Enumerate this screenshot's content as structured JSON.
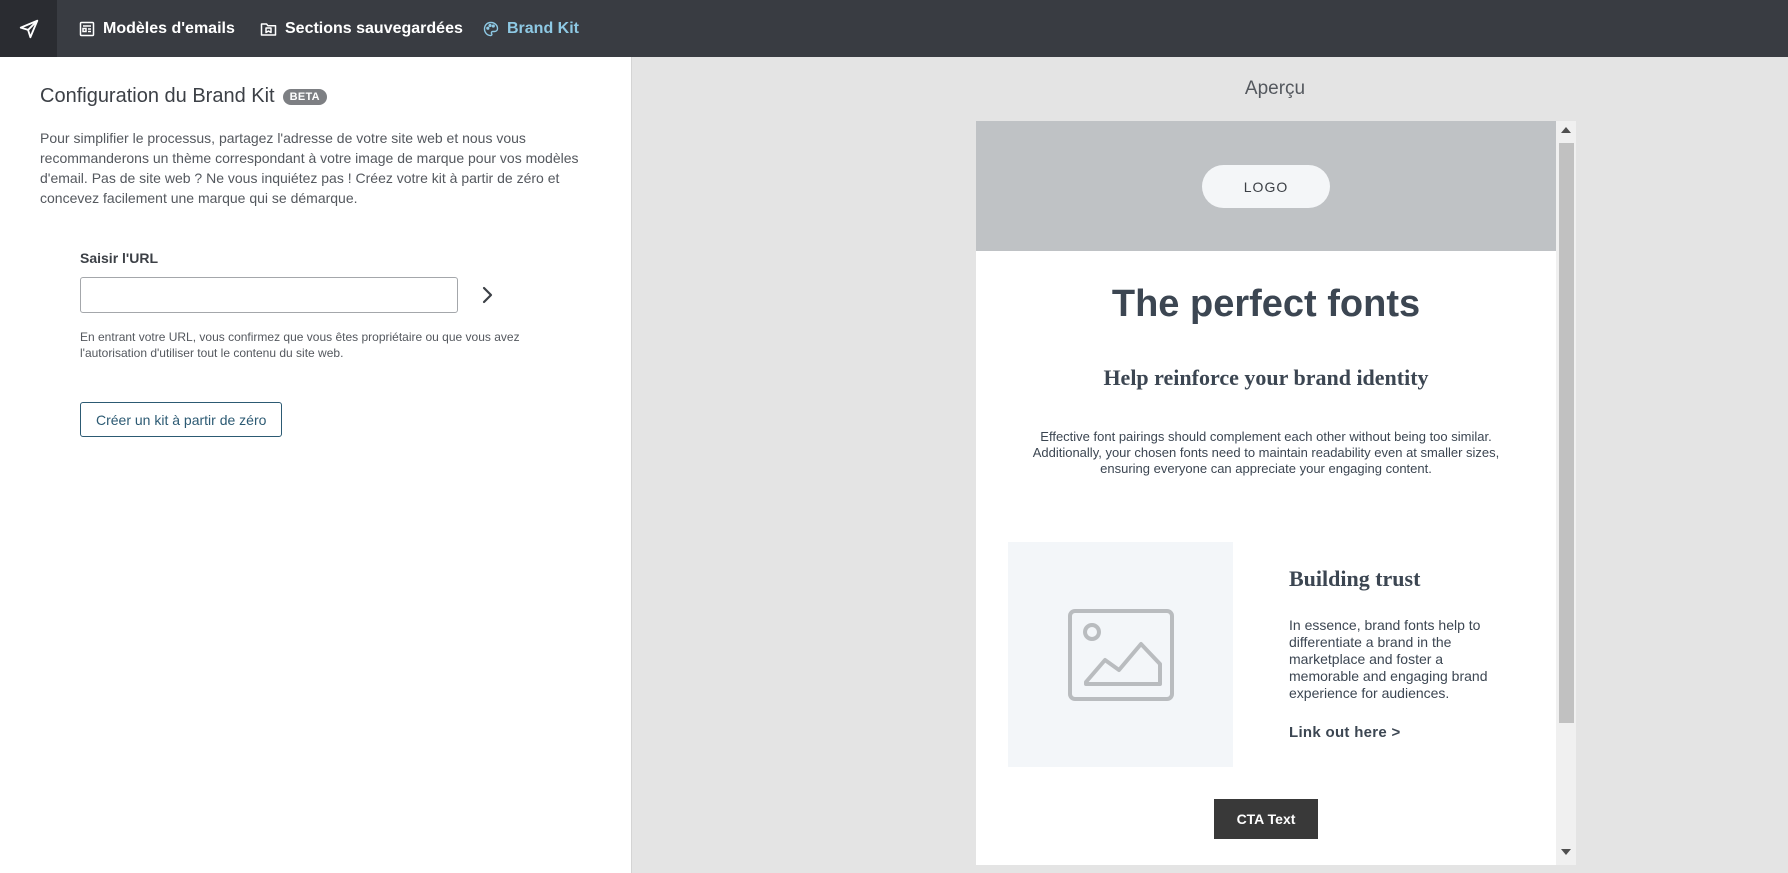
{
  "nav": {
    "items": [
      {
        "label": "Modèles d'emails",
        "icon": "template-icon"
      },
      {
        "label": "Sections sauvegardées",
        "icon": "saved-folder-icon"
      },
      {
        "label": "Brand Kit",
        "icon": "palette-icon",
        "active": true
      }
    ]
  },
  "config": {
    "title": "Configuration du Brand Kit",
    "badge": "BETA",
    "intro": "Pour simplifier le processus, partagez l'adresse de votre site web et nous vous recommanderons un thème correspondant à votre image de marque pour vos modèles d'email. Pas de site web ? Ne vous inquiétez pas ! Créez votre kit à partir de zéro et concevez facilement une marque qui se démarque.",
    "url_label": "Saisir l'URL",
    "url_value": "",
    "disclaimer": "En entrant votre URL, vous confirmez que vous êtes propriétaire ou que vous avez l'autorisation d'utiliser tout le contenu du site web.",
    "scratch_button": "Créer un kit à partir de zéro"
  },
  "preview": {
    "title": "Aperçu",
    "logo": "LOGO",
    "heading": "The perfect fonts",
    "subheading": "Help reinforce your brand identity",
    "body": "Effective font pairings should complement each other without being too similar. Additionally, your chosen fonts need to maintain readability even at smaller sizes, ensuring everyone can appreciate your engaging content.",
    "card_heading": "Building trust",
    "card_text": "In essence, brand fonts help to differentiate a brand in the marketplace and foster a memorable and engaging brand experience for audiences.",
    "link_text": "Link out here >",
    "cta": "CTA Text"
  },
  "colors": {
    "nav_bg": "#393c42",
    "nav_active": "#8ec9e4",
    "accent": "#2c5a73",
    "cta_bg": "#393939"
  }
}
